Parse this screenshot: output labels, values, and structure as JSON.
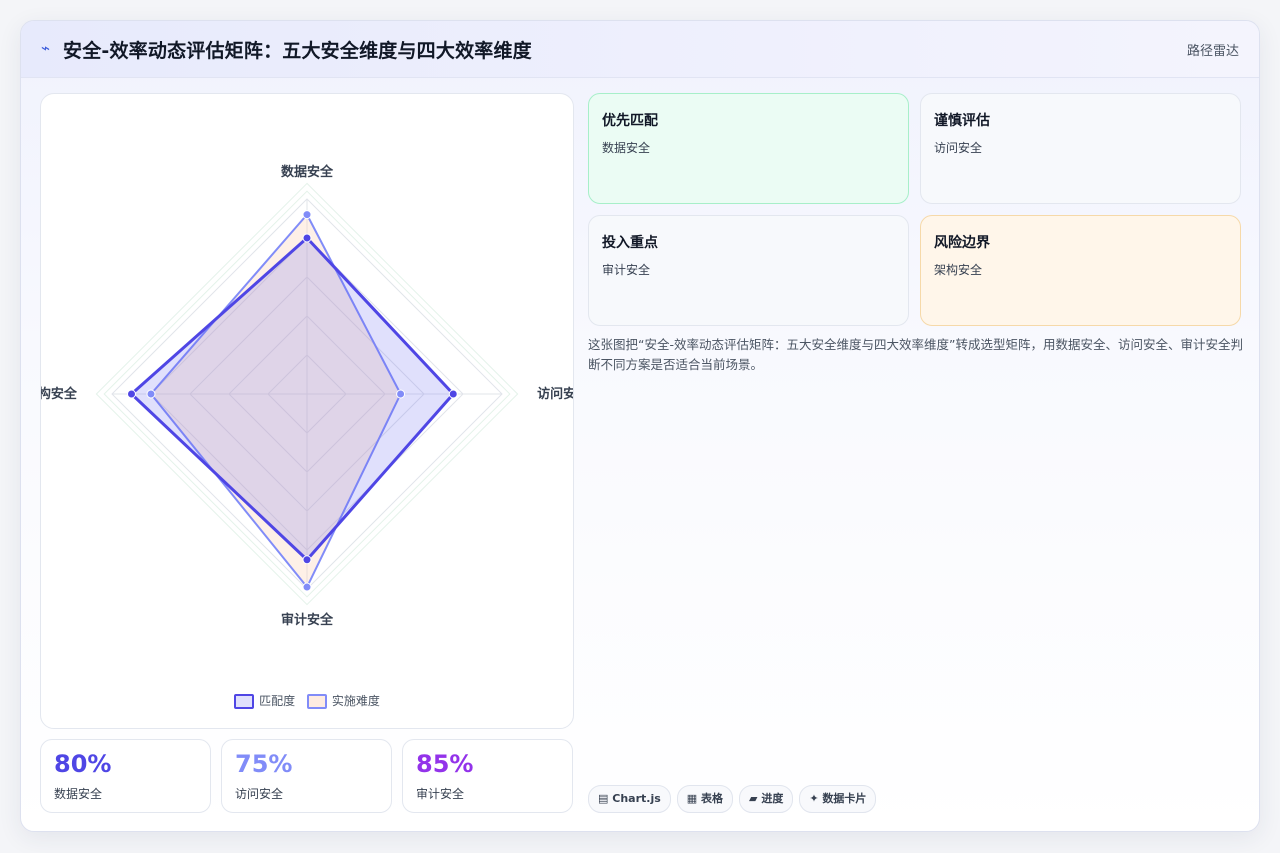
{
  "header": {
    "icon": "⌁",
    "title": "安全-效率动态评估矩阵：五大安全维度与四大效率维度",
    "tag": "路径雷达"
  },
  "chart_data": {
    "type": "radar",
    "axes": [
      "数据安全",
      "访问安全",
      "审计安全",
      "架构安全"
    ],
    "rmax": 100,
    "rings": 5,
    "series": [
      {
        "name": "匹配度",
        "values": [
          80,
          75,
          85,
          90
        ],
        "color": "#4f46e5",
        "fill": "rgba(99,102,241,0.20)"
      },
      {
        "name": "实施难度",
        "values": [
          92,
          48,
          99,
          80
        ],
        "color": "#818cf8",
        "fill": "rgba(251,200,170,0.28)"
      }
    ]
  },
  "stats": [
    {
      "value": "80%",
      "label": "数据安全",
      "color": "#4f46e5"
    },
    {
      "value": "75%",
      "label": "访问安全",
      "color": "#818cf8"
    },
    {
      "value": "85%",
      "label": "审计安全",
      "color": "#9333ea"
    }
  ],
  "quadrants": [
    {
      "title": "优先匹配",
      "sub": "数据安全",
      "bg": "#ebfcf4",
      "border": "#a7efc9"
    },
    {
      "title": "谨慎评估",
      "sub": "访问安全",
      "bg": "#f7f9fc",
      "border": "#e3e7ef"
    },
    {
      "title": "投入重点",
      "sub": "审计安全",
      "bg": "#f7f9fc",
      "border": "#e3e7ef"
    },
    {
      "title": "风险边界",
      "sub": "架构安全",
      "bg": "#fff6ea",
      "border": "#f6d9a9"
    }
  ],
  "description": "这张图把“安全-效率动态评估矩阵：五大安全维度与四大效率维度”转成选型矩阵，用数据安全、访问安全、审计安全判断不同方案是否适合当前场景。",
  "chips": [
    {
      "icon": "▤",
      "label": "Chart.js"
    },
    {
      "icon": "▦",
      "label": "表格"
    },
    {
      "icon": "▰",
      "label": "进度"
    },
    {
      "icon": "✦",
      "label": "数据卡片"
    }
  ]
}
